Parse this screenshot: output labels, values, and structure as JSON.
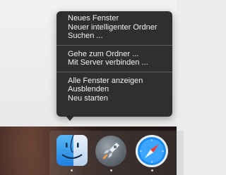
{
  "context_menu": {
    "group1": [
      "Neues Fenster",
      "Neuer intelligenter Ordner",
      "Suchen ..."
    ],
    "group2": [
      "Gehe zum Ordner ...",
      "Mit Server verbinden ..."
    ],
    "group3": [
      "Alle Fenster anzeigen",
      "Ausblenden",
      "Neu starten"
    ]
  },
  "dock": {
    "items": [
      {
        "icon": "finder-icon",
        "running": true
      },
      {
        "icon": "launchpad-icon",
        "running": true
      },
      {
        "icon": "safari-icon",
        "running": true
      }
    ]
  }
}
